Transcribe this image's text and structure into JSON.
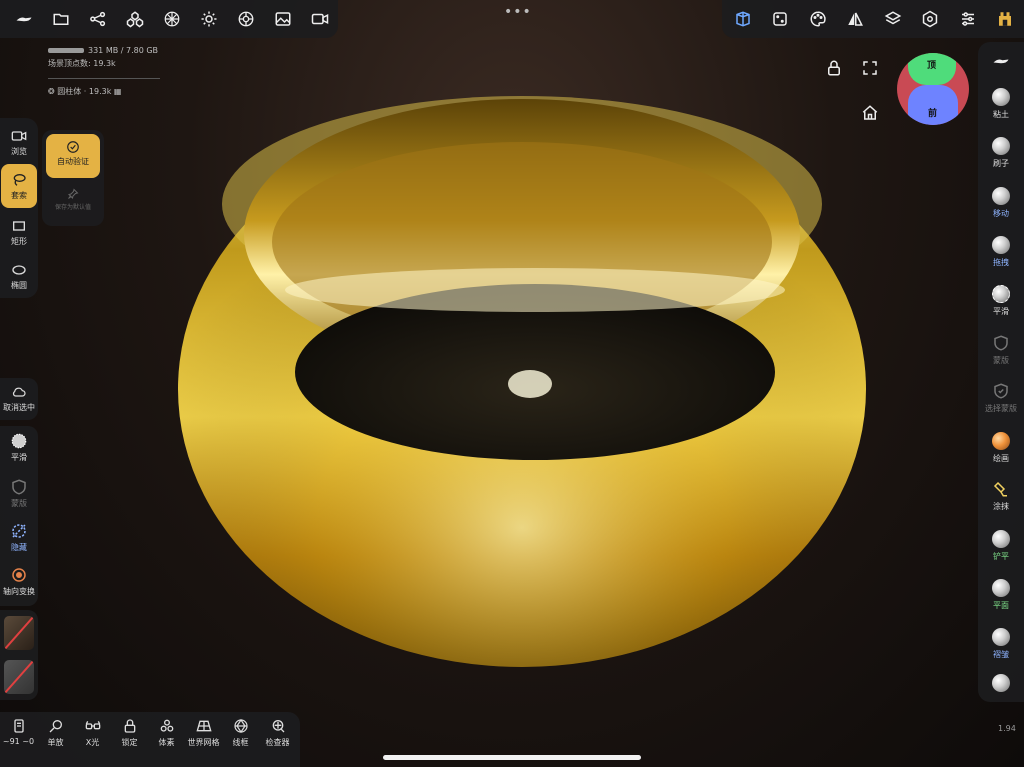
{
  "top_left_toolbar": {
    "icons": [
      "nomad-logo-icon",
      "folder-icon",
      "scene-graph-icon",
      "primitives-icon",
      "material-sphere-icon",
      "light-icon",
      "environment-icon",
      "image-icon",
      "video-icon"
    ]
  },
  "top_right_toolbar": {
    "icons": [
      "topology-icon",
      "dice-icon",
      "palette-icon",
      "symmetry-icon",
      "layers-icon",
      "settings-icon",
      "sliders-icon",
      "store-icon"
    ]
  },
  "stats": {
    "memory": "331 MB / 7.80 GB",
    "vertex_count": "场景顶点数: 19.3k",
    "object_name": "圆柱体",
    "object_verts": "19.3k"
  },
  "gizmo": {
    "top_label": "顶",
    "front_label": "前",
    "colors": {
      "top": "#4fdc7b",
      "front": "#6e83ff",
      "side": "#c94a54"
    }
  },
  "left_tools": [
    {
      "label": "浏览",
      "icon": "camera-icon"
    },
    {
      "label": "套索",
      "icon": "lasso-icon",
      "active": true
    },
    {
      "label": "矩形",
      "icon": "rectangle-icon"
    },
    {
      "label": "椭圆",
      "icon": "ellipse-icon"
    }
  ],
  "submenu": {
    "auto_verify": "自动验证",
    "save_default": "保存为默认值"
  },
  "deselect": "取消选中",
  "left_tools2": [
    {
      "label": "平滑",
      "icon": "smooth-icon"
    },
    {
      "label": "蒙版",
      "icon": "mask-icon"
    },
    {
      "label": "隐藏",
      "icon": "hide-icon"
    },
    {
      "label": "轴向变换",
      "icon": "axis-transform-icon"
    }
  ],
  "right_tools": [
    {
      "label": "粘土",
      "icon": "clay-icon",
      "color": "normal"
    },
    {
      "label": "刷子",
      "icon": "brush-icon",
      "color": "normal"
    },
    {
      "label": "移动",
      "icon": "move-icon",
      "color": "blue"
    },
    {
      "label": "拖拽",
      "icon": "drag-icon",
      "color": "blue"
    },
    {
      "label": "平滑",
      "icon": "smooth-icon",
      "color": "normal"
    },
    {
      "label": "蒙版",
      "icon": "mask-icon",
      "color": "dim"
    },
    {
      "label": "选择蒙版",
      "icon": "select-mask-icon",
      "color": "dim"
    },
    {
      "label": "绘画",
      "icon": "paint-icon",
      "color": "normal"
    },
    {
      "label": "涂抹",
      "icon": "smudge-icon",
      "color": "normal"
    },
    {
      "label": "铲平",
      "icon": "flatten-icon",
      "color": "green"
    },
    {
      "label": "平面",
      "icon": "planar-icon",
      "color": "green"
    },
    {
      "label": "褶皱",
      "icon": "crease-icon",
      "color": "blue"
    }
  ],
  "bottom_bar": [
    {
      "label": "~91 ~0",
      "icon": "history-icon"
    },
    {
      "label": "单放",
      "icon": "zoom-icon"
    },
    {
      "label": "X光",
      "icon": "xray-icon"
    },
    {
      "label": "锁定",
      "icon": "lock-icon"
    },
    {
      "label": "体素",
      "icon": "voxel-icon"
    },
    {
      "label": "世界网格",
      "icon": "world-grid-icon"
    },
    {
      "label": "线框",
      "icon": "wireframe-icon"
    },
    {
      "label": "检查器",
      "icon": "inspector-icon"
    }
  ],
  "version": "1.94"
}
